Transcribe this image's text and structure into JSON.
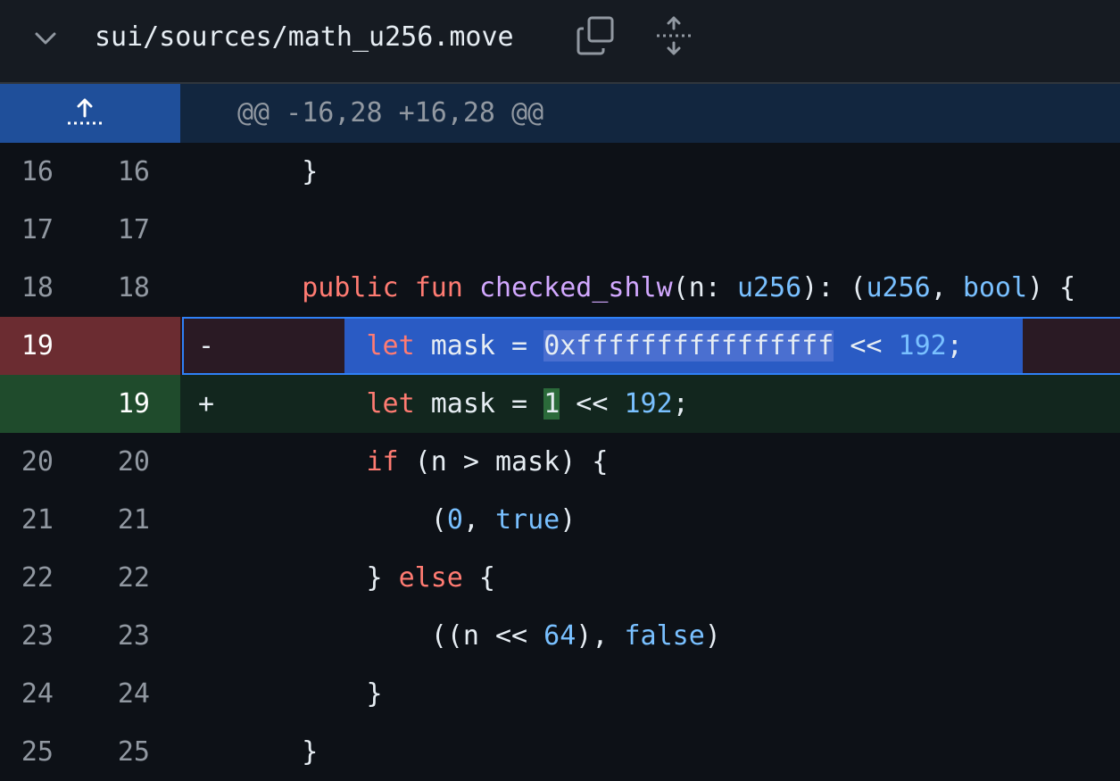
{
  "file": {
    "path": "sui/sources/math_u256.move",
    "icons": {
      "collapse": "chevron-down-icon",
      "copy": "copy-icon",
      "expand": "expand-icon"
    }
  },
  "hunk": {
    "header": "@@ -16,28 +16,28 @@",
    "icon": "expand-up-icon"
  },
  "lines": [
    {
      "old": "16",
      "new": "16",
      "type": "context",
      "code": "    }"
    },
    {
      "old": "17",
      "new": "17",
      "type": "context",
      "code": ""
    },
    {
      "old": "18",
      "new": "18",
      "type": "context",
      "code": "    public fun checked_shlw(n: u256): (u256, bool) {"
    },
    {
      "old": "19",
      "new": "",
      "type": "del",
      "marker": "-",
      "code": "        let mask = 0xffffffffffffffff << 192;"
    },
    {
      "old": "",
      "new": "19",
      "type": "add",
      "marker": "+",
      "code": "        let mask = 1 << 192;"
    },
    {
      "old": "20",
      "new": "20",
      "type": "context",
      "code": "        if (n > mask) {"
    },
    {
      "old": "21",
      "new": "21",
      "type": "context",
      "code": "            (0, true)"
    },
    {
      "old": "22",
      "new": "22",
      "type": "context",
      "code": "        } else {"
    },
    {
      "old": "23",
      "new": "23",
      "type": "context",
      "code": "            ((n << 64), false)"
    },
    {
      "old": "24",
      "new": "24",
      "type": "context",
      "code": "        }"
    },
    {
      "old": "25",
      "new": "25",
      "type": "context",
      "code": "    }"
    }
  ],
  "colors": {
    "background": "#0d1117",
    "deleted_gutter": "#6b2c31",
    "added_gutter": "#1f4b2c",
    "selection": "#2f81f7",
    "keyword": "#ff7b72",
    "function": "#d2a8ff",
    "type": "#79c0ff"
  }
}
